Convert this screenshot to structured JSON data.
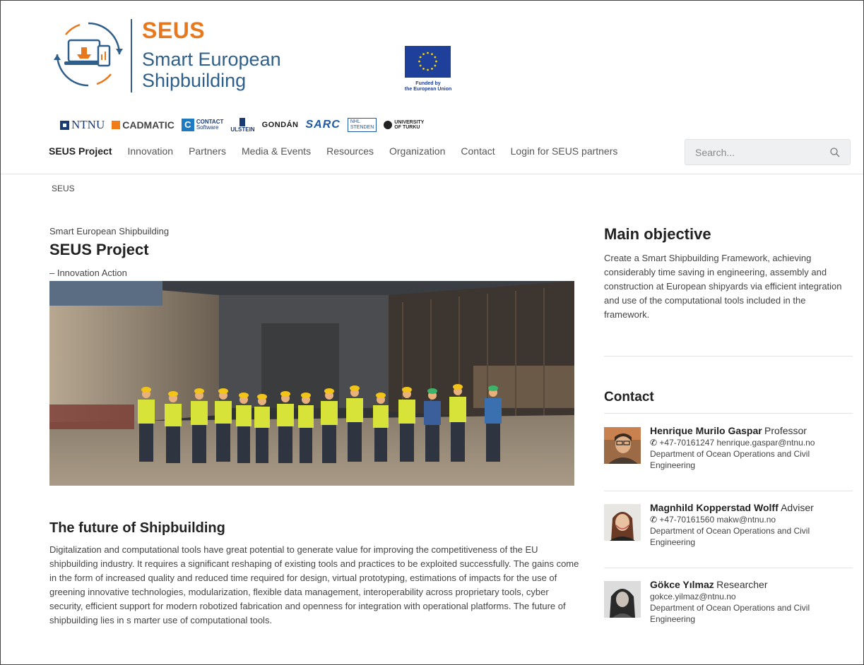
{
  "brand": {
    "acronym": "SEUS",
    "name_line1": "Smart European",
    "name_line2": "Shipbuilding",
    "eu_caption": "Funded by\nthe European Union",
    "colors": {
      "orange": "#e8781e",
      "blue": "#2e5f8a",
      "eu_blue": "#1e3f9a"
    }
  },
  "partners": {
    "ntnu": "NTNU",
    "cadmatic": "CADMATIC",
    "contact": "CONTACT",
    "contact_sub": "Software",
    "ulstein": "ULSTEIN",
    "gondan": "GONDÁN",
    "sarc": "SARC",
    "nhl": "NHL",
    "nhl_sub": "STENDEN",
    "turku": "UNIVERSITY",
    "turku_sub": "OF TURKU"
  },
  "nav": {
    "items": [
      {
        "label": "SEUS Project",
        "active": true
      },
      {
        "label": "Innovation"
      },
      {
        "label": "Partners"
      },
      {
        "label": "Media & Events"
      },
      {
        "label": "Resources"
      },
      {
        "label": "Organization"
      },
      {
        "label": "Contact"
      },
      {
        "label": "Login for SEUS partners"
      }
    ]
  },
  "search": {
    "placeholder": "Search..."
  },
  "breadcrumb": "SEUS",
  "main": {
    "subtitle": "Smart European Shipbuilding",
    "title": "SEUS Project",
    "tagline": "– Innovation Action",
    "section_title": "The future of Shipbuilding",
    "section_body": "Digitalization and computational tools have great potential to generate value for improving the competitiveness of the EU shipbuilding industry. It requires a significant reshaping of existing tools and practices to be exploited successfully. The gains come in the form of increased quality and reduced time required for design, virtual prototyping, estimations of impacts for the use of greening innovative technologies, modularization, flexible data management, interoperability across proprietary tools, cyber security, efficient support for modern robotized fabrication and openness for integration with operational platforms. The future of shipbuilding lies in s marter use of computational tools."
  },
  "sidebar": {
    "objective_title": "Main objective",
    "objective_body": "Create a Smart Shipbuilding Framework, achieving considerably time saving in engineering, assembly and construction at European shipyards via efficient integration and use of the computational tools included in the framework.",
    "contact_title": "Contact",
    "contacts": [
      {
        "name": "Henrique Murilo Gaspar",
        "role": "Professor",
        "phone": "+47-70161247",
        "email": "henrique.gaspar@ntnu.no",
        "department": "Department of Ocean Operations and Civil Engineering"
      },
      {
        "name": "Magnhild Kopperstad Wolff",
        "role": "Adviser",
        "phone": "+47-70161560",
        "email": "makw@ntnu.no",
        "department": "Department of Ocean Operations and Civil Engineering"
      },
      {
        "name": "Gökce Yılmaz",
        "role": "Researcher",
        "email": "gokce.yilmaz@ntnu.no",
        "department": "Department of Ocean Operations and Civil Engineering"
      }
    ]
  }
}
